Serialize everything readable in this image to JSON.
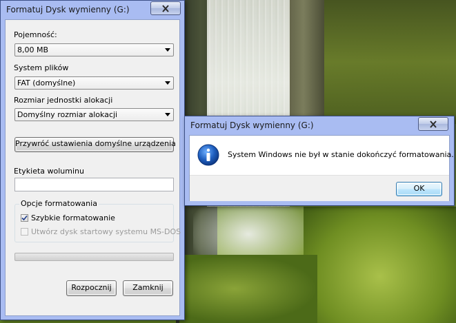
{
  "format_dialog": {
    "title": "Formatuj Dysk wymienny (G:)",
    "capacity": {
      "label": "Pojemność:",
      "value": "8,00 MB"
    },
    "file_system": {
      "label": "System plików",
      "value": "FAT (domyślne)"
    },
    "allocation_unit": {
      "label": "Rozmiar jednostki alokacji",
      "value": "Domyślny rozmiar alokacji"
    },
    "restore_defaults_label": "Przywróć ustawienia domyślne urządzenia",
    "volume_label": {
      "label": "Etykieta woluminu",
      "value": ""
    },
    "format_options": {
      "title": "Opcje formatowania",
      "quick_format": {
        "label": "Szybkie formatowanie",
        "checked": true
      },
      "msdos_startup": {
        "label": "Utwórz dysk startowy systemu MS-DOS",
        "checked": false,
        "enabled": false
      }
    },
    "progress": 0,
    "start_label": "Rozpocznij",
    "close_label": "Zamknij"
  },
  "message_box": {
    "title": "Formatuj Dysk wymienny (G:)",
    "icon": "info-icon",
    "message": "System Windows nie był w stanie dokończyć formatowania.",
    "ok_label": "OK"
  },
  "colors": {
    "frame": "#a9bcf2",
    "client": "#f0f0f0",
    "info_icon": "#1f5fbf"
  }
}
